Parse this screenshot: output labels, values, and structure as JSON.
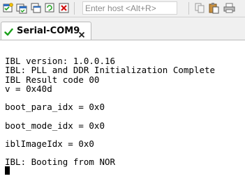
{
  "toolbar": {
    "host_placeholder": "Enter host <Alt+R>",
    "buttons": [
      "new-session-icon",
      "open-session-icon",
      "clone-session-icon",
      "options-icon",
      "disconnect-icon",
      "copy-icon",
      "paste-icon",
      "print-icon"
    ]
  },
  "tabs": [
    {
      "label": "Serial-COM9",
      "status": "connected"
    }
  ],
  "terminal": {
    "lines": [
      "",
      "IBL version: 1.0.0.16",
      "IBL: PLL and DDR Initialization Complete",
      "IBL Result code 00",
      "v = 0x40d",
      "",
      "boot_para_idx = 0x0",
      "",
      "boot_mode_idx = 0x0",
      "",
      "iblImageIdx = 0x0",
      "",
      "IBL: Booting from NOR"
    ]
  },
  "colors": {
    "toolbar_bg": "#f0f0f0",
    "terminal_bg": "#ffffff",
    "terminal_fg": "#000000",
    "connected_check": "#1aa01a"
  }
}
